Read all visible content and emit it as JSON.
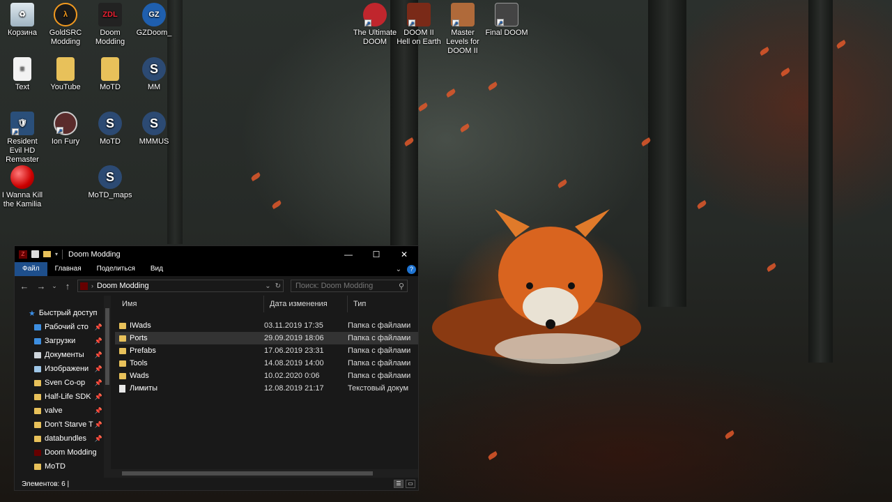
{
  "desktop": {
    "icons": [
      {
        "label": "Корзина",
        "icon": "recycle-bin-icon"
      },
      {
        "label": "GoldSRC Modding",
        "icon": "half-life-lambda-icon"
      },
      {
        "label": "Doom Modding",
        "icon": "zdl-launcher-icon"
      },
      {
        "label": "GZDoom_",
        "icon": "gzdoom-icon"
      },
      {
        "label": "Text",
        "icon": "documents-icon"
      },
      {
        "label": "YouTube",
        "icon": "folder-icon"
      },
      {
        "label": "MoTD",
        "icon": "folder-icon"
      },
      {
        "label": "MM",
        "icon": "slade-icon"
      },
      {
        "label": "Resident Evil HD Remaster",
        "icon": "shortcut-shield-icon"
      },
      {
        "label": "Ion Fury",
        "icon": "ion-fury-icon"
      },
      {
        "label": "MoTD",
        "icon": "slade-icon"
      },
      {
        "label": "MMMUS",
        "icon": "slade-icon"
      },
      {
        "label": "I Wanna Kill the Kamilia",
        "icon": "red-ball-icon"
      },
      {
        "label": "MoTD_maps",
        "icon": "slade-icon"
      },
      {
        "label": "The Ultimate DOOM",
        "icon": "doom-cacodemon-icon"
      },
      {
        "label": "DOOM II Hell on Earth",
        "icon": "doom-2-icon"
      },
      {
        "label": "Master Levels for DOOM II",
        "icon": "doomguy-face-icon"
      },
      {
        "label": "Final DOOM",
        "icon": "final-doom-icon"
      }
    ]
  },
  "explorer": {
    "title": "Doom Modding",
    "ribbon": {
      "tabs": [
        "Файл",
        "Главная",
        "Поделиться",
        "Вид"
      ],
      "help": "?"
    },
    "address": "Doom Modding",
    "search_placeholder": "Поиск: Doom Modding",
    "columns": {
      "name": "Имя",
      "date": "Дата изменения",
      "type": "Тип"
    },
    "nav_items": [
      {
        "label": "Быстрый доступ",
        "pinned": false,
        "kind": "quick-access"
      },
      {
        "label": "Рабочий сто",
        "pinned": true,
        "kind": "desktop"
      },
      {
        "label": "Загрузки",
        "pinned": true,
        "kind": "downloads"
      },
      {
        "label": "Документы",
        "pinned": true,
        "kind": "documents"
      },
      {
        "label": "Изображени",
        "pinned": true,
        "kind": "pictures"
      },
      {
        "label": "Sven Co-op",
        "pinned": true,
        "kind": "folder"
      },
      {
        "label": "Half-Life SDK",
        "pinned": true,
        "kind": "folder"
      },
      {
        "label": "valve",
        "pinned": true,
        "kind": "folder"
      },
      {
        "label": "Don't Starve T",
        "pinned": true,
        "kind": "folder"
      },
      {
        "label": "databundles",
        "pinned": true,
        "kind": "folder"
      },
      {
        "label": "Doom Modding",
        "pinned": false,
        "kind": "zdl"
      },
      {
        "label": "MoTD",
        "pinned": false,
        "kind": "folder"
      }
    ],
    "files": [
      {
        "name": "IWads",
        "date": "03.11.2019 17:35",
        "type": "Папка с файлами",
        "kind": "folder"
      },
      {
        "name": "Ports",
        "date": "29.09.2019 18:06",
        "type": "Папка с файлами",
        "kind": "folder",
        "selected": true
      },
      {
        "name": "Prefabs",
        "date": "17.06.2019 23:31",
        "type": "Папка с файлами",
        "kind": "folder"
      },
      {
        "name": "Tools",
        "date": "14.08.2019 14:00",
        "type": "Папка с файлами",
        "kind": "folder"
      },
      {
        "name": "Wads",
        "date": "10.02.2020 0:06",
        "type": "Папка с файлами",
        "kind": "folder"
      },
      {
        "name": "Лимиты",
        "date": "12.08.2019 21:17",
        "type": "Текстовый докум",
        "kind": "text"
      }
    ],
    "status": "Элементов: 6  |",
    "accent": "#1e4f8c"
  }
}
